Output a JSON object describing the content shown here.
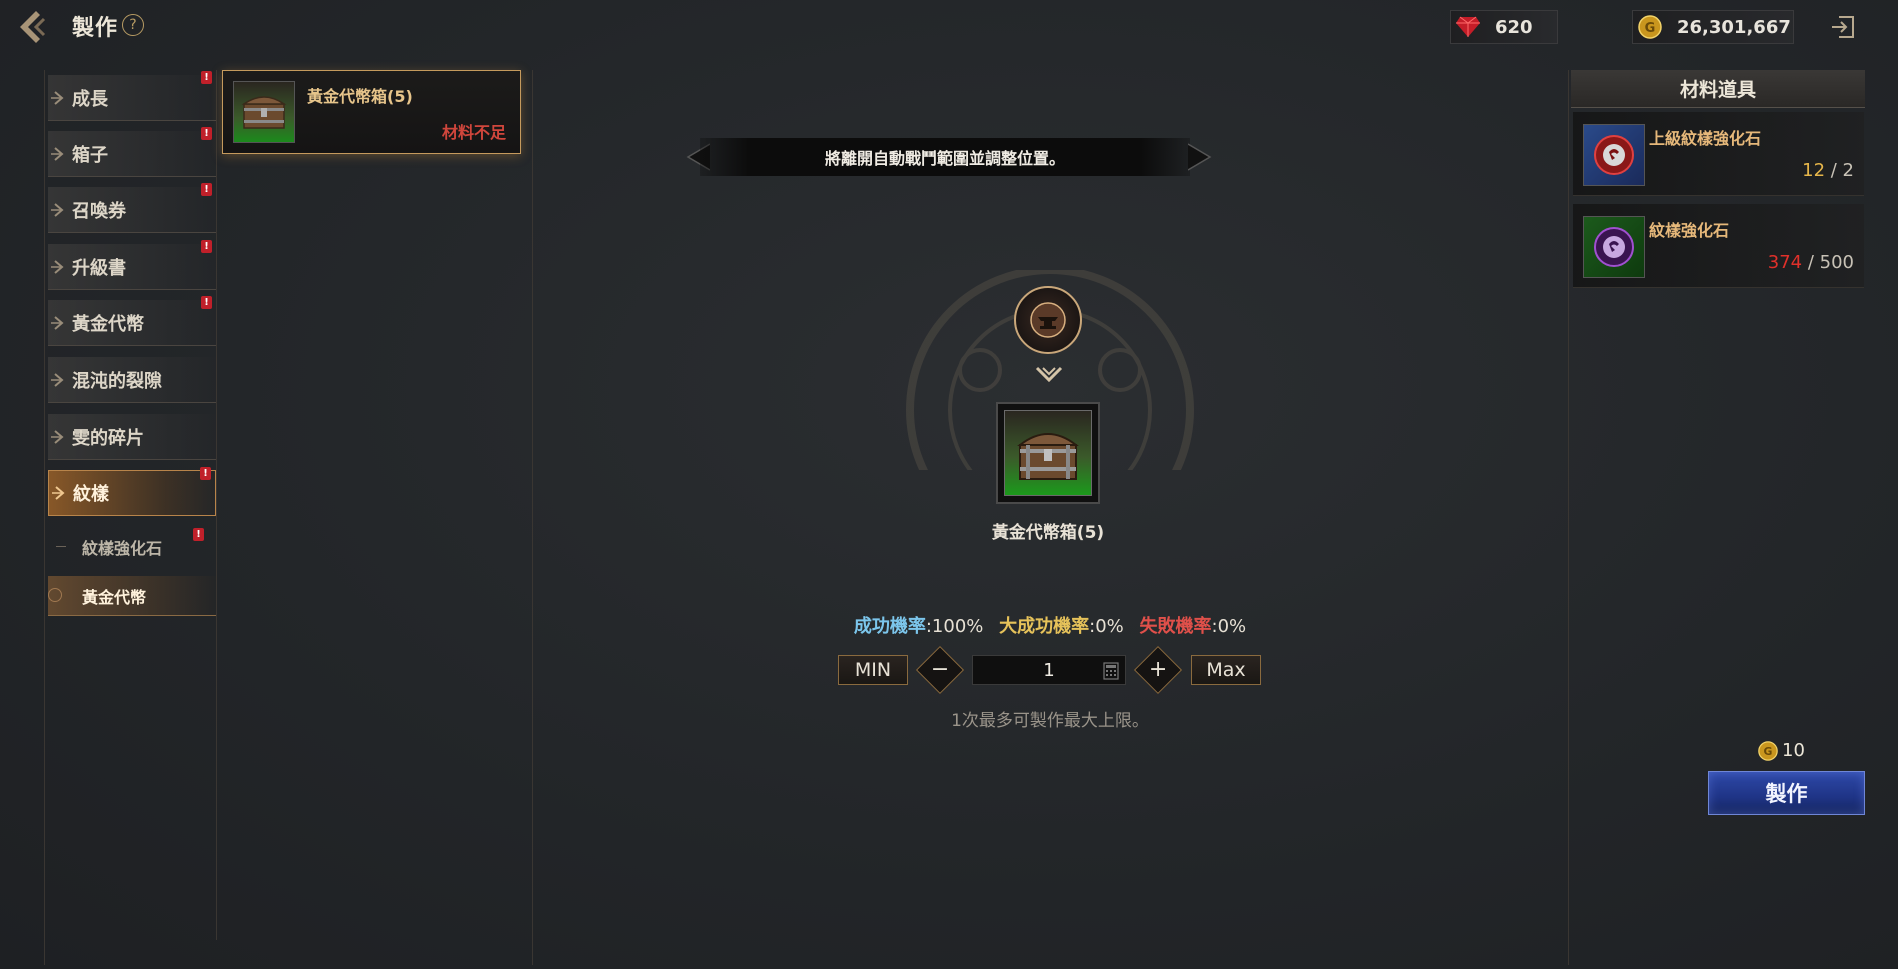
{
  "header": {
    "title": "製作",
    "help_symbol": "?",
    "gem_amount": "620",
    "gold_amount": "26,301,667"
  },
  "sidebar": {
    "categories": [
      {
        "label": "成長",
        "badge": "!"
      },
      {
        "label": "箱子",
        "badge": "!"
      },
      {
        "label": "召喚券",
        "badge": "!"
      },
      {
        "label": "升級書",
        "badge": "!"
      },
      {
        "label": "黃金代幣",
        "badge": "!"
      },
      {
        "label": "混沌的裂隙",
        "badge": ""
      },
      {
        "label": "雯的碎片",
        "badge": ""
      },
      {
        "label": "紋樣",
        "badge": "!"
      }
    ],
    "subcategories": [
      {
        "label": "紋樣強化石",
        "badge": "!"
      },
      {
        "label": "黃金代幣",
        "badge": ""
      }
    ]
  },
  "recipe_list": [
    {
      "name": "黃金代幣箱(5)",
      "status": "材料不足"
    }
  ],
  "notice": "將離開自動戰鬥範圍並調整位置。",
  "result": {
    "name": "黃金代幣箱(5)"
  },
  "rates": {
    "success_label": "成功機率",
    "success_value": "100%",
    "great_label": "大成功機率",
    "great_value": "0%",
    "fail_label": "失敗機率",
    "fail_value": "0%",
    "separator": ":"
  },
  "quantity": {
    "min_label": "MIN",
    "max_label": "Max",
    "minus_symbol": "−",
    "plus_symbol": "+",
    "value": "1",
    "limit_note": "1次最多可製作最大上限。"
  },
  "materials": {
    "header": "材料道具",
    "items": [
      {
        "name": "上級紋樣強化石",
        "have": "12",
        "need": "2",
        "sufficient": true
      },
      {
        "name": "紋樣強化石",
        "have": "374",
        "need": "500",
        "sufficient": false
      }
    ],
    "count_separator": " / "
  },
  "craft": {
    "cost": "10",
    "button_label": "製作"
  },
  "colors": {
    "accent_gold": "#c59a5d",
    "craft_blue": "#1f3486",
    "insufficient_red": "#d0463c",
    "success_blue": "#7cc6ec",
    "great_success_yellow": "#e6c25a",
    "fail_red": "#e0504a"
  }
}
